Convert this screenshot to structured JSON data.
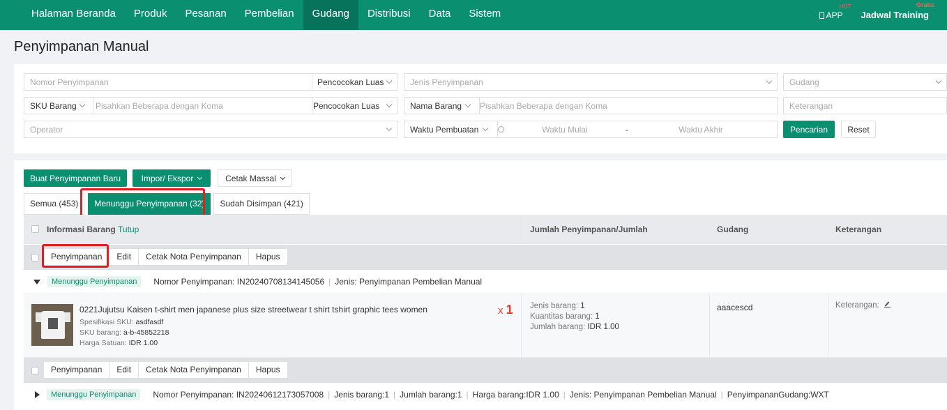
{
  "nav": {
    "items": [
      "Halaman Beranda",
      "Produk",
      "Pesanan",
      "Pembelian",
      "Gudang",
      "Distribusi",
      "Data",
      "Sistem"
    ],
    "active": "Gudang",
    "app_label": "APP",
    "app_badge": "HOT",
    "training_label": "Jadwal Training",
    "training_badge": "Gratis"
  },
  "page_title": "Penyimpanan Manual",
  "filters": {
    "nomor_placeholder": "Nomor Penyimpanan",
    "match1": "Pencocokan Luas",
    "jenis_placeholder": "Jenis Penyimpanan",
    "gudang_placeholder": "Gudang",
    "sku_select": "SKU Barang",
    "sku_placeholder": "Pisahkan Beberapa dengan Koma",
    "match2": "Pencocokan Luas",
    "nama_select": "Nama Barang",
    "nama_placeholder": "Pisahkan Beberapa dengan Koma",
    "keterangan_placeholder": "Keterangan",
    "operator_placeholder": "Operator",
    "waktu_select": "Waktu Pembuatan",
    "waktu_mulai": "Waktu Mulai",
    "waktu_dash": "-",
    "waktu_akhir": "Waktu Akhir",
    "search_button": "Pencarian",
    "reset_button": "Reset"
  },
  "toolbar": {
    "new_button": "Buat Penyimpanan Baru",
    "import_button": "Impor/ Ekspor",
    "print_button": "Cetak Massal"
  },
  "tabs": [
    {
      "label": "Semua (453)",
      "active": false
    },
    {
      "label": "Menunggu Penyimpanan (32)",
      "active": true
    },
    {
      "label": "Sudah Disimpan (421)",
      "active": false
    }
  ],
  "table": {
    "col_info": "Informasi Barang",
    "col_info_link": "Tutup",
    "col_qty": "Jumlah Penyimpanan/Jumlah",
    "col_gudang": "Gudang",
    "col_ket": "Keterangan"
  },
  "actions": [
    "Penyimpanan",
    "Edit",
    "Cetak Nota Penyimpanan",
    "Hapus"
  ],
  "order1": {
    "status": "Menunggu Penyimpanan",
    "nomor": "Nomor Penyimpanan: IN20240708134145056",
    "jenis": "Jenis: Penyimpanan Pembelian Manual",
    "item": {
      "title": "0221Jujutsu Kaisen t-shirt men japanese plus size streetwear t shirt tshirt graphic tees women",
      "spec_label": "Spesifikasi SKU:",
      "spec_value": "asdfasdf",
      "sku_label": "SKU barang:",
      "sku_value": "a-b-45852218",
      "price_label": "Harga Satuan:",
      "price_value": "IDR 1.00",
      "qty_prefix": "x",
      "qty": "1",
      "jenis_label": "Jenis barang:",
      "jenis_value": "1",
      "kuantitas_label": "Kuantitas barang:",
      "kuantitas_value": "1",
      "jumlah_label": "Jumlah barang:",
      "jumlah_value": "IDR 1.00",
      "gudang": "aaacescd",
      "keterangan_label": "Keterangan:"
    }
  },
  "order2": {
    "status": "Menunggu Penyimpanan",
    "nomor": "Nomor Penyimpanan: IN20240612173057008",
    "jenis_barang": "Jenis barang:1",
    "jumlah_barang": "Jumlah barang:1",
    "harga_barang": "Harga barang:IDR 1.00",
    "jenis": "Jenis: Penyimpanan Pembelian Manual",
    "gudang": "PenyimpananGudang:WXT"
  },
  "colors": {
    "brand": "#0a8f70",
    "highlight": "#e02020"
  }
}
